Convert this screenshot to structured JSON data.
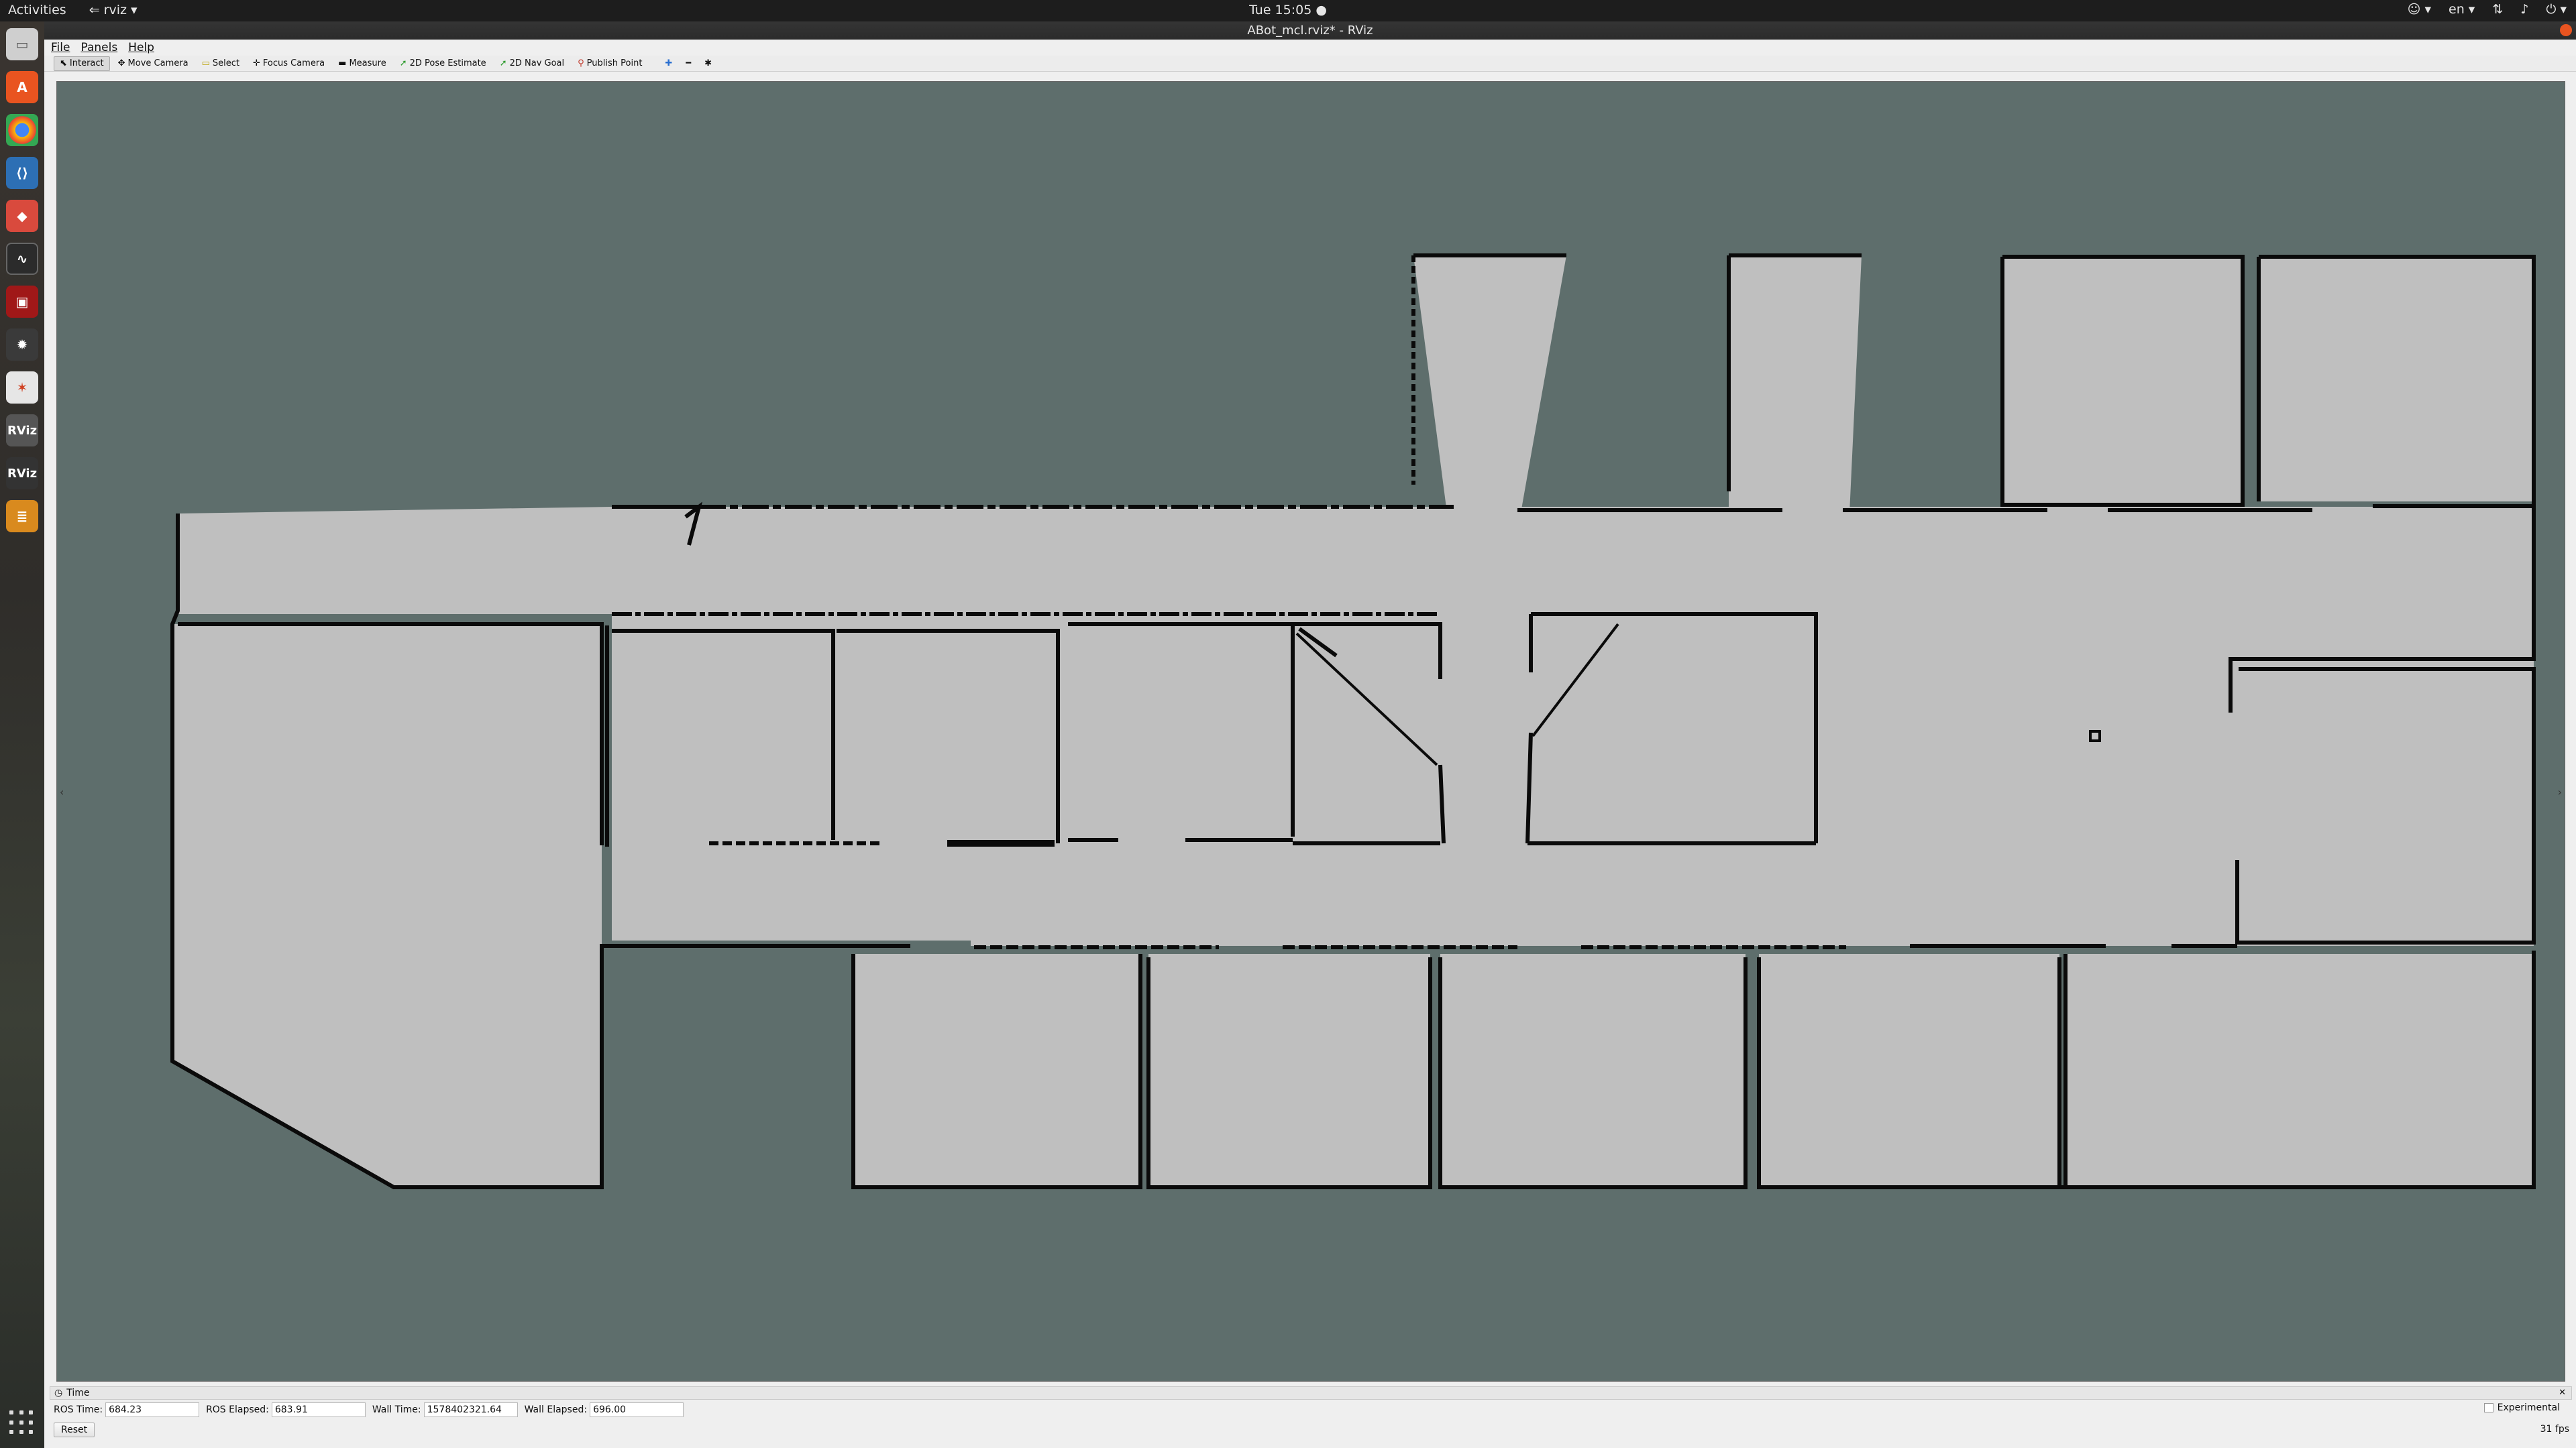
{
  "topbar": {
    "activities": "Activities",
    "app_menu": "rviz",
    "clock": "Tue 15:05",
    "language": "en"
  },
  "window": {
    "title": "ABot_mcl.rviz* - RViz"
  },
  "menu": {
    "file": "File",
    "panels": "Panels",
    "help": "Help"
  },
  "toolbar": {
    "interact": "Interact",
    "move_camera": "Move Camera",
    "select": "Select",
    "focus_camera": "Focus Camera",
    "measure": "Measure",
    "pose_estimate": "2D Pose Estimate",
    "nav_goal": "2D Nav Goal",
    "publish_point": "Publish Point"
  },
  "time_panel": {
    "title": "Time",
    "ros_time_label": "ROS Time:",
    "ros_time": "684.23",
    "ros_elapsed_label": "ROS Elapsed:",
    "ros_elapsed": "683.91",
    "wall_time_label": "Wall Time:",
    "wall_time": "1578402321.64",
    "wall_elapsed_label": "Wall Elapsed:",
    "wall_elapsed": "696.00",
    "experimental": "Experimental",
    "reset": "Reset",
    "fps": "31 fps"
  },
  "colors": {
    "unknown_space": "#5e6e6c",
    "free_space": "#bfbfbf",
    "walls": "#0a0a0a",
    "dock_red": "#e95420"
  }
}
